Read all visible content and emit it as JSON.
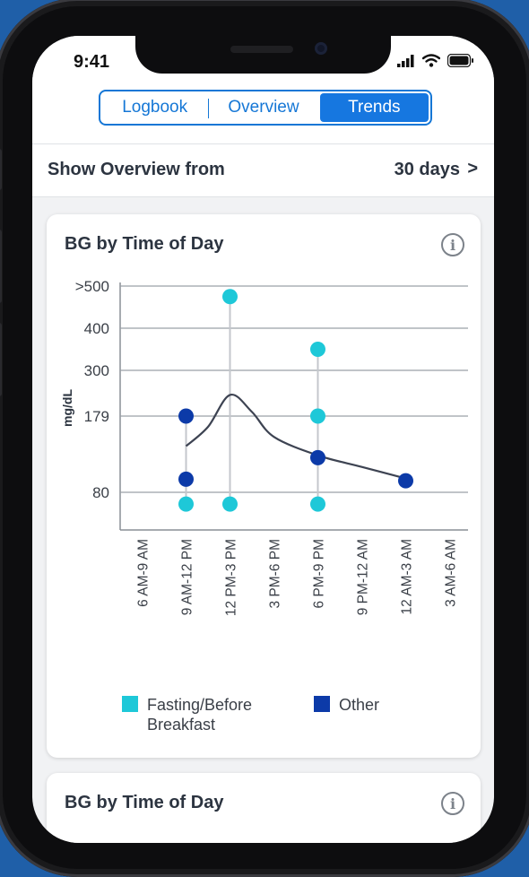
{
  "status_bar": {
    "time": "9:41"
  },
  "tabs": [
    {
      "label": "Logbook",
      "active": false
    },
    {
      "label": "Overview",
      "active": false
    },
    {
      "label": "Trends",
      "active": true
    }
  ],
  "overview": {
    "label": "Show Overview from",
    "value": "30 days"
  },
  "cards": [
    {
      "title": "BG by Time of Day"
    },
    {
      "title": "BG by Time of Day"
    }
  ],
  "colors": {
    "accent": "#1677e0",
    "fasting": "#1ec8d8",
    "other": "#0c3aa8",
    "trend_line": "#3d4352"
  },
  "legend": [
    {
      "label": "Fasting/Before Breakfast",
      "color": "#1ec8d8"
    },
    {
      "label": "Other",
      "color": "#0c3aa8"
    }
  ],
  "chart_data": {
    "type": "scatter",
    "title": "BG by Time of Day",
    "ylabel": "mg/dL",
    "y_ticks": [
      {
        "label": ">500",
        "value": 500
      },
      {
        "label": "400",
        "value": 400
      },
      {
        "label": "300",
        "value": 300
      },
      {
        "label": "179",
        "value": 179
      },
      {
        "label": "80",
        "value": 80
      }
    ],
    "categories": [
      "6 AM-9 AM",
      "9 AM-12 PM",
      "12 PM-3 PM",
      "3 PM-6 PM",
      "6 PM-9 PM",
      "9 PM-12 AM",
      "12 AM-3 AM",
      "3 AM-6 AM"
    ],
    "series": [
      {
        "name": "Fasting/Before Breakfast",
        "points": [
          {
            "category": "9 AM-12 PM",
            "value": 55
          },
          {
            "category": "12 PM-3 PM",
            "value": 475
          },
          {
            "category": "12 PM-3 PM",
            "value": 55
          },
          {
            "category": "6 PM-9 PM",
            "value": 350
          },
          {
            "category": "6 PM-9 PM",
            "value": 179
          },
          {
            "category": "6 PM-9 PM",
            "value": 55
          }
        ]
      },
      {
        "name": "Other",
        "points": [
          {
            "category": "9 AM-12 PM",
            "value": 179
          },
          {
            "category": "9 AM-12 PM",
            "value": 97
          },
          {
            "category": "6 PM-9 PM",
            "value": 125
          },
          {
            "category": "12 AM-3 AM",
            "value": 95
          }
        ]
      }
    ],
    "trend": [
      {
        "x": 1.0,
        "y": 140
      },
      {
        "x": 1.5,
        "y": 165
      },
      {
        "x": 2.0,
        "y": 235
      },
      {
        "x": 2.5,
        "y": 190
      },
      {
        "x": 3.0,
        "y": 152
      },
      {
        "x": 4.0,
        "y": 128
      },
      {
        "x": 5.0,
        "y": 113
      },
      {
        "x": 6.0,
        "y": 98
      }
    ]
  }
}
